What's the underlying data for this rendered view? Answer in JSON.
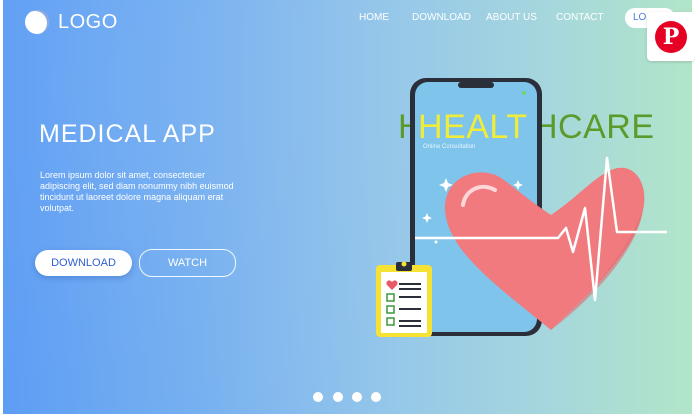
{
  "header": {
    "logo_text": "LOGO",
    "nav": [
      "HOME",
      "DOWNLOAD",
      "ABOUT US",
      "CONTACT"
    ],
    "login_label": "LO"
  },
  "pinterest": {
    "icon": "pinterest-icon",
    "glyph": "P",
    "color": "#e60023"
  },
  "hero": {
    "title": "MEDICAL APP",
    "body": "Lorem ipsum dolor sit amet, consectetuer adipiscing elit, sed diam nonummy nibh euismod tincidunt ut laoreet dolore magna aliquam erat volutpat.",
    "download_label": "DOWNLOAD",
    "watch_label": "WATCH"
  },
  "illustration": {
    "word_part1": "HEALT",
    "word_part2": "HCARE",
    "word_back_prefix": "H",
    "screen_caption": "Online Consultation",
    "colors": {
      "word_yellow": "#f0ed3a",
      "word_green": "#5d9a2c",
      "heart": "#f07a7e"
    }
  },
  "slider": {
    "count": 4,
    "active": 0
  }
}
